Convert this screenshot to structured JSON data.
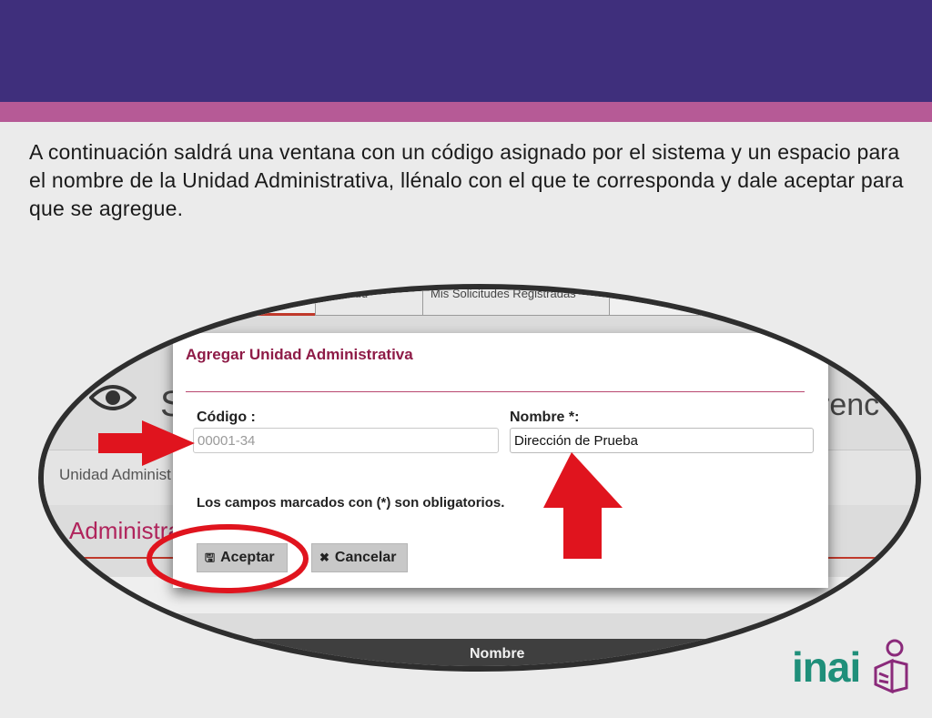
{
  "slide": {
    "instruction": "A continuación saldrá una ventana con un código asignado por el sistema y un espacio para el nombre de la Unidad Administrativa, llénalo con el que te corresponda y dale aceptar para que se agregue."
  },
  "background_app": {
    "tabs": [
      "Solicitud",
      "Mis Solicitudes Registradas"
    ],
    "header_partial_left": "S",
    "header_partial_right": "renc",
    "breadcrumb": "Unidad Administ",
    "section_title": "Administra",
    "table_header": "Nombre"
  },
  "dialog": {
    "title": "Agregar Unidad Administrativa",
    "codigo_label": "Código :",
    "codigo_value": "00001-34",
    "nombre_label": "Nombre *:",
    "nombre_value": "Dirección de Prueba",
    "required_note": "Los campos marcados con (*) son obligatorios.",
    "accept_label": "Aceptar",
    "cancel_label": "Cancelar"
  },
  "icons": {
    "accept": "save-icon",
    "cancel": "close-icon",
    "eye": "eye-icon"
  },
  "brand": {
    "logo_text": "inai",
    "banner_color": "#3f2f7c",
    "stripe_color": "#b65a96",
    "logo_color": "#1f8f7a",
    "annotation_color": "#e0141e"
  }
}
